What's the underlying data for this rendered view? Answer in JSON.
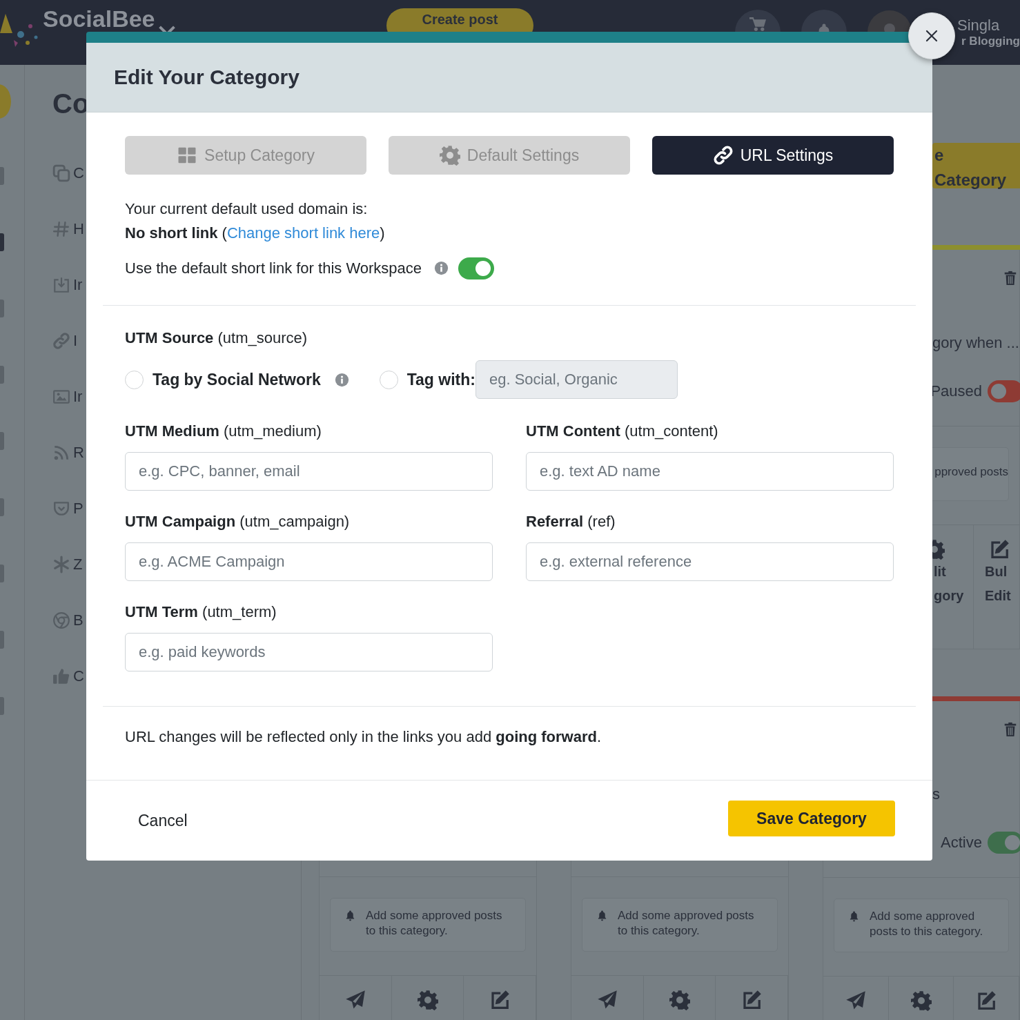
{
  "topbar": {
    "logo": "SocialBee",
    "create_button": "Create post",
    "user_name": "Singla",
    "workspace": "r Blogging"
  },
  "sidebar": {
    "title": "Co",
    "items": [
      {
        "kind": "copy",
        "label": "C"
      },
      {
        "kind": "hash",
        "label": "H"
      },
      {
        "kind": "import",
        "label": "Ir"
      },
      {
        "kind": "link",
        "label": "I"
      },
      {
        "kind": "image",
        "label": "Ir"
      },
      {
        "kind": "rss",
        "label": "R"
      },
      {
        "kind": "pocket",
        "label": "P"
      },
      {
        "kind": "asterisk",
        "label": "Z"
      },
      {
        "kind": "chrome",
        "label": "B"
      },
      {
        "kind": "thumb",
        "label": "C"
      }
    ]
  },
  "header_button": "e Category",
  "columns": [
    {
      "cards": [
        {
          "notice": "Add some approved posts to this category.",
          "actions": [
            {
              "kind": "send"
            },
            {
              "kind": "gear"
            },
            {
              "kind": "edit"
            }
          ]
        }
      ]
    },
    {
      "cards": [
        {
          "notice": "Add some approved posts to this category.",
          "actions": [
            {
              "kind": "send"
            },
            {
              "kind": "gear"
            },
            {
              "kind": "edit"
            }
          ]
        }
      ]
    },
    {
      "cards": [
        {
          "color": "#8c8f2f",
          "description": "gory when ...",
          "status": "Paused",
          "on": false,
          "notice": "pproved posts",
          "actions": [
            {
              "kind": "gear",
              "label_lines": [
                "lit",
                "gory"
              ]
            },
            {
              "kind": "edit",
              "label_lines": [
                "Bul",
                "Edit"
              ]
            }
          ]
        },
        {
          "color": "#8e3b34",
          "description": "s",
          "status": "Active",
          "on": true,
          "notice": "Add some approved posts to this category.",
          "actions": [
            {
              "kind": "send"
            },
            {
              "kind": "gear"
            },
            {
              "kind": "edit"
            }
          ]
        }
      ]
    }
  ],
  "modal": {
    "title": "Edit Your Category",
    "tabs": [
      {
        "label": "Setup Category",
        "kind": "grid",
        "selected": false
      },
      {
        "label": "Default Settings",
        "kind": "gear",
        "selected": false
      },
      {
        "label": "URL Settings",
        "kind": "link",
        "selected": true
      }
    ],
    "domain_text": "Your current default used domain is:",
    "short_link": {
      "prefix": "**No short link** (",
      "link": "Change short link here",
      "suffix": ")"
    },
    "default_toggle": {
      "label": "Use the default short link for this Workspace",
      "on": true
    },
    "utm_source": {
      "label": "**UTM Source** (utm_source)",
      "options": [
        {
          "label": "Tag by Social Network",
          "info": true,
          "selected": false
        },
        {
          "label": "Tag with:",
          "selected": false,
          "field": {
            "placeholder": "eg. Social, Organic",
            "disabled": true
          }
        }
      ]
    },
    "fields": [
      {
        "label": "**UTM Medium** (utm_medium)",
        "placeholder": "e.g. CPC, banner, email"
      },
      {
        "label": "**UTM Content** (utm_content)",
        "placeholder": "e.g. text AD name"
      },
      {
        "label": "**UTM Campaign** (utm_campaign)",
        "placeholder": "e.g. ACME Campaign"
      },
      {
        "label": "**Referral** (ref)",
        "placeholder": "e.g. external reference"
      },
      {
        "label": "**UTM Term** (utm_term)",
        "placeholder": "e.g. paid keywords"
      }
    ],
    "note": "URL changes will be reflected only in the links you add **going forward**.",
    "cancel": "Cancel",
    "save": "Save Category"
  }
}
